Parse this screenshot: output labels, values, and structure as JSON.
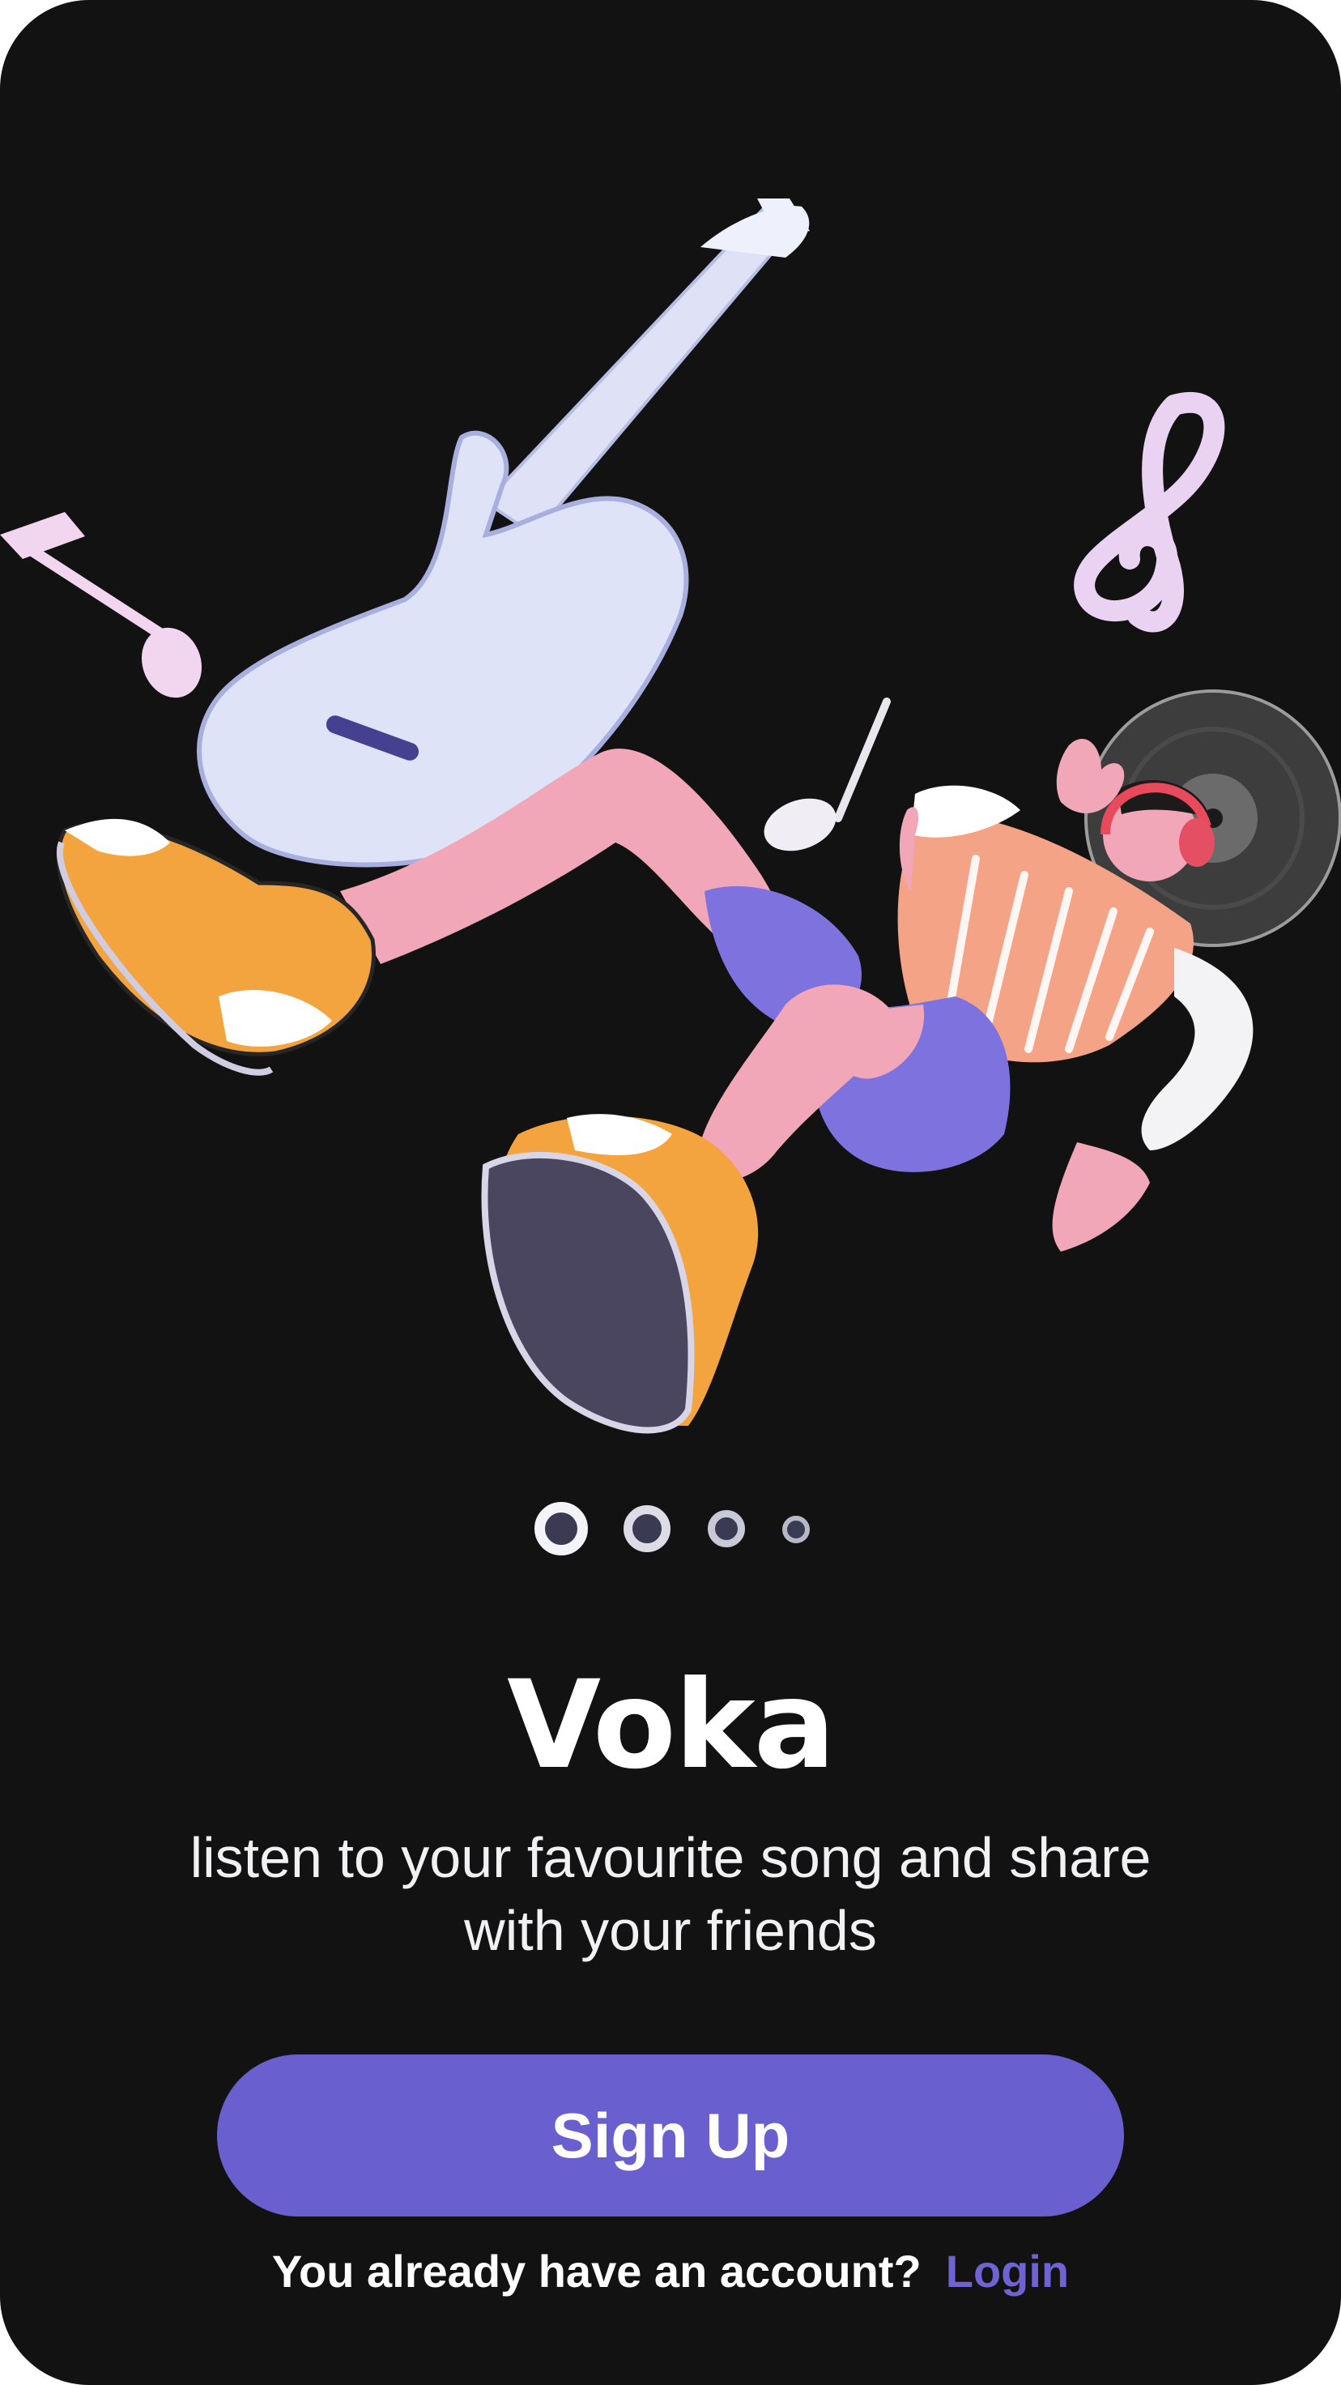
{
  "app": {
    "title": "Voka",
    "tagline": "listen to your favourite song and share with your friends"
  },
  "hero": {
    "illustration": "musician-floating-with-guitar",
    "icons": [
      "guitar-icon",
      "treble-clef-icon",
      "music-note-icon",
      "vinyl-record-icon",
      "headphones-icon"
    ]
  },
  "pagination": {
    "total": 4,
    "current": 1
  },
  "actions": {
    "signup_label": "Sign Up",
    "login_prompt": "You already have an account?",
    "login_label": "Login"
  },
  "colors": {
    "background": "#121212",
    "accent": "#6a5fcf",
    "link": "#6f63d4",
    "text": "#ffffff"
  }
}
